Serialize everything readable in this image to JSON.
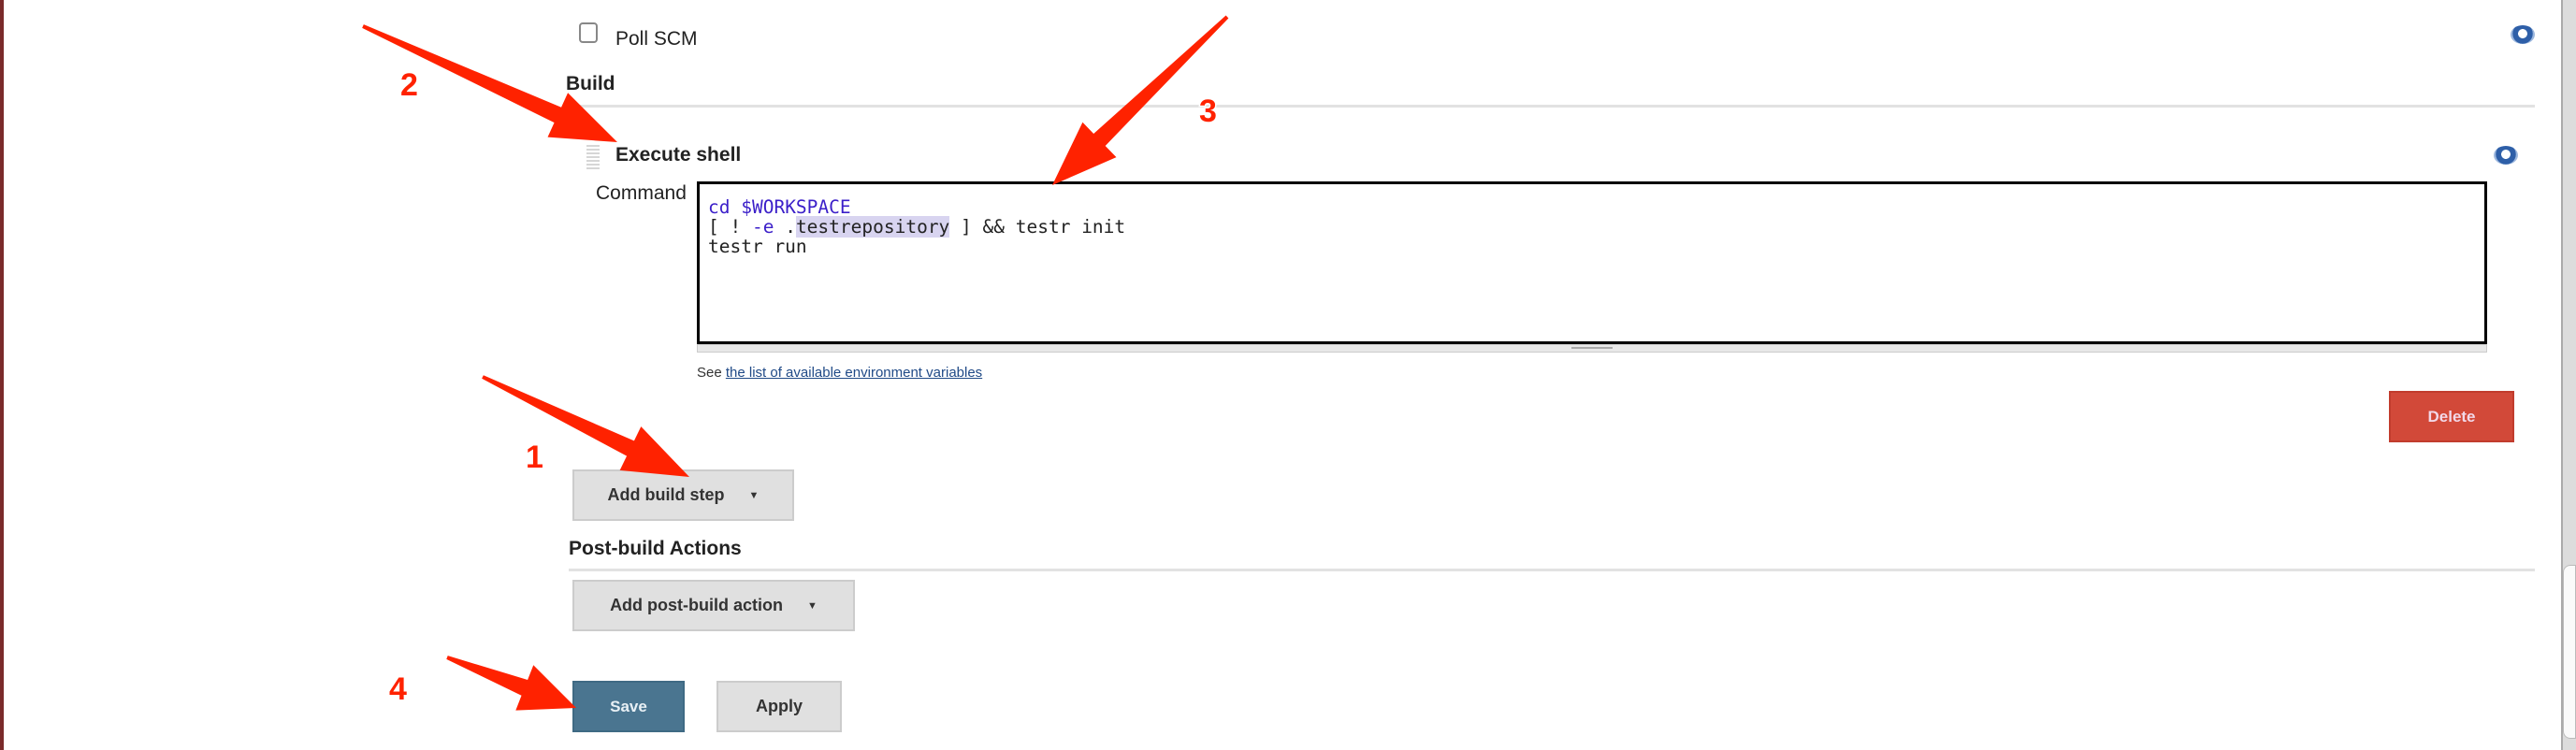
{
  "triggers": {
    "poll_scm_label": "Poll SCM",
    "poll_scm_checked": false
  },
  "build": {
    "heading": "Build",
    "step": {
      "title": "Execute shell",
      "command_label": "Command",
      "command_lines": [
        "cd $WORKSPACE",
        "[ ! -e .testrepository ] && testr init",
        "testr run"
      ],
      "see_prefix": "See ",
      "env_link": "the list of available environment variables",
      "delete_label": "Delete"
    },
    "add_step_label": "Add build step"
  },
  "post_build": {
    "heading": "Post-build Actions",
    "add_action_label": "Add post-build action"
  },
  "footer": {
    "save_label": "Save",
    "apply_label": "Apply"
  },
  "help_icon_glyph": "?",
  "annotations": {
    "numbers": [
      "1",
      "2",
      "3",
      "4"
    ],
    "color": "#ff2200"
  },
  "colors": {
    "save": "#4a7590",
    "delete": "#d24939",
    "link": "#204a87"
  }
}
